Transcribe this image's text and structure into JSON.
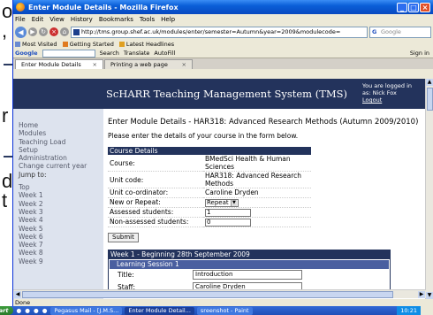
{
  "slide_fragments": [
    {
      "text": "o"
    },
    {
      "text": ","
    },
    {
      "text": "r"
    },
    {
      "text": "d"
    },
    {
      "text": "t"
    }
  ],
  "window": {
    "title": "Enter Module Details - Mozilla Firefox"
  },
  "menubar": [
    "File",
    "Edit",
    "View",
    "History",
    "Bookmarks",
    "Tools",
    "Help"
  ],
  "navbar": {
    "url": "http://tms.group.shef.ac.uk/modules/enter/semester=Autumn&year=2009&modulecode=",
    "search_placeholder": "Google"
  },
  "bookmarks": [
    "Most Visited",
    "Getting Started",
    "Latest Headlines"
  ],
  "gtoolbar": {
    "label": "Google",
    "items": [
      "Search",
      "Translate",
      "AutoFill"
    ],
    "signin": "Sign in"
  },
  "tabs": [
    {
      "label": "Enter Module Details"
    },
    {
      "label": "Printing a web page"
    }
  ],
  "site": {
    "title": "ScHARR Teaching Management System (TMS)",
    "logged_in": "You are logged in as: Nick Fox",
    "logout": "Logout"
  },
  "sidebar": {
    "top": [
      "Home",
      "Modules",
      "Teaching Load",
      "Setup",
      "Administration",
      "Change current year"
    ],
    "jump_label": "Jump to:",
    "jump": [
      "Top",
      "Week 1",
      "Week 2",
      "Week 3",
      "Week 4",
      "Week 5",
      "Week 6",
      "Week 7",
      "Week 8",
      "Week 9"
    ]
  },
  "main": {
    "heading": "Enter Module Details - HAR318: Advanced Research Methods (Autumn 2009/2010)",
    "intro": "Please enter the details of your course in the form below.",
    "course_details": "Course Details",
    "course_label": "Course:",
    "course_value": "BMedSci Health & Human Sciences",
    "unit_code_label": "Unit code:",
    "unit_code_value": "HAR318: Advanced Research Methods",
    "coordinator_label": "Unit co-ordinator:",
    "coordinator_value": "Caroline Dryden",
    "new_repeat_label": "New or Repeat:",
    "new_repeat_value": "Repeat",
    "assessed_label": "Assessed students:",
    "assessed_value": "1",
    "non_assessed_label": "Non-assessed students:",
    "non_assessed_value": "0",
    "submit": "Submit",
    "week_heading": "Week 1 - Beginning 28th September 2009",
    "session_heading": "Learning Session 1",
    "title_label": "Title:",
    "title_value": "Introduction",
    "staff_label": "Staff:",
    "staff_value": "Caroline Dryden"
  },
  "statusbar": "Done",
  "taskbar": {
    "start": "Start",
    "tasks": [
      {
        "label": "Pegasus Mail - [J.M.S..."
      },
      {
        "label": "Enter Module Detail..."
      },
      {
        "label": "sreenshot - Paint"
      }
    ],
    "clock": "10:21"
  }
}
